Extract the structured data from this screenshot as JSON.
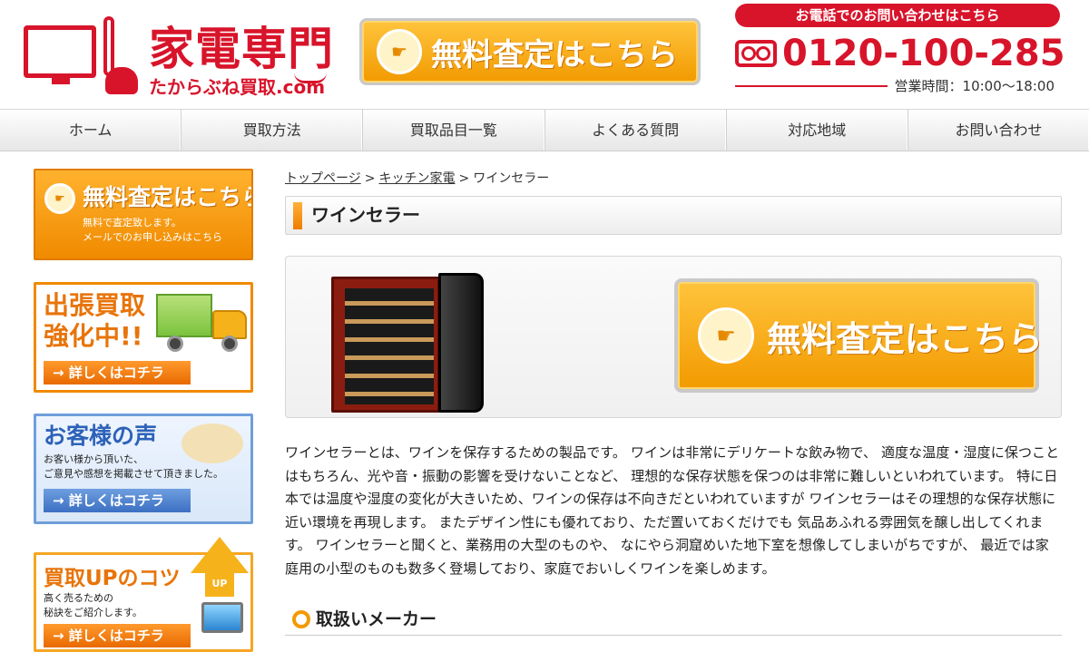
{
  "header": {
    "logo_title": "家電専門",
    "logo_sub": "たからぶね買取.com",
    "cta_label": "無料査定はこちら",
    "cta_icon": "pointing-hand-icon",
    "phone_heading": "お電話でのお問い合わせはこちら",
    "phone_number": "0120-100-285",
    "phone_icon": "free-dial-icon",
    "business_hours": "営業時間：10:00〜18:00"
  },
  "nav": {
    "items": [
      {
        "label": "ホーム"
      },
      {
        "label": "買取方法"
      },
      {
        "label": "買取品目一覧"
      },
      {
        "label": "よくある質問"
      },
      {
        "label": "対応地域"
      },
      {
        "label": "お問い合わせ"
      }
    ]
  },
  "sidebar": {
    "assessment": {
      "title": "無料査定はこちら",
      "line1": "無料で査定致します。",
      "line2": "メールでのお申し込みはこちら"
    },
    "trip": {
      "title_line1": "出張買取",
      "title_line2": "強化中!!",
      "more": "→ 詳しくはコチラ"
    },
    "voice": {
      "title": "お客様の声",
      "line1": "お客い様から頂いた、",
      "line2": "ご意見や感想を掲載させて頂きました。",
      "more": "→ 詳しくはコチラ"
    },
    "tips": {
      "title": "買取UPのコツ",
      "line1": "高く売るための",
      "line2": "秘訣をご紹介します。",
      "badge": "UP",
      "more": "→ 詳しくはコチラ"
    }
  },
  "main": {
    "breadcrumb": [
      {
        "label": "トップページ"
      },
      {
        "label": "キッチン家電"
      },
      {
        "label": "ワインセラー"
      }
    ],
    "breadcrumb_sep": ">",
    "page_title": "ワインセラー",
    "hero_cta_label": "無料査定はこちら",
    "description": "ワインセラーとは、ワインを保存するための製品です。 ワインは非常にデリケートな飲み物で、 適度な温度・湿度に保つことはもちろん、光や音・振動の影響を受けないことなど、 理想的な保存状態を保つのは非常に難しいといわれています。 特に日本では温度や湿度の変化が大きいため、ワインの保存は不向きだといわれていますが ワインセラーはその理想的な保存状態に近い環境を再現します。 またデザイン性にも優れており、ただ置いておくだけでも 気品あふれる雰囲気を醸し出してくれます。 ワインセラーと聞くと、業務用の大型のものや、 なにやら洞窟めいた地下室を想像してしまいがちですが、 最近では家庭用の小型のものも数多く登場しており、家庭でおいしくワインを楽しめます。",
    "makers_heading": "取扱いメーカー"
  },
  "colors": {
    "brand_red": "#d8142b",
    "accent_orange": "#f29a00",
    "voice_blue": "#3c6fc2"
  }
}
